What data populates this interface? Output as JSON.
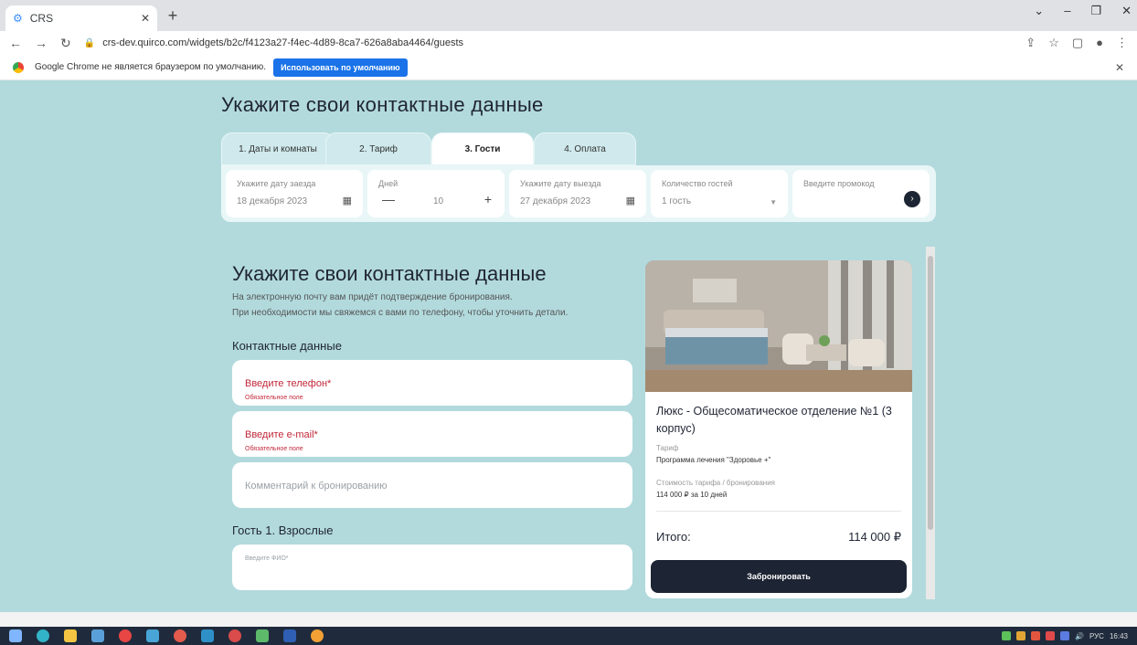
{
  "browser": {
    "tab_title": "CRS",
    "url": "crs-dev.quirco.com/widgets/b2c/f4123a27-f4ec-4d89-8ca7-626a8aba4464/guests",
    "infobar_text": "Google Chrome не является браузером по умолчанию.",
    "infobar_button": "Использовать по умолчанию"
  },
  "page": {
    "header_title": "Укажите свои контактные данные",
    "steps": [
      "1. Даты и комнаты",
      "2. Тариф",
      "3. Гости",
      "4. Оплата"
    ],
    "active_step": 3
  },
  "filters": {
    "checkin_label": "Укажите дату заезда",
    "checkin_value": "18 декабря 2023",
    "days_label": "Дней",
    "days_value": "10",
    "checkout_label": "Укажите дату выезда",
    "checkout_value": "27 декабря 2023",
    "guests_label": "Количество гостей",
    "guests_value": "1 гость",
    "promo_label": "Введите промокод"
  },
  "form": {
    "title": "Укажите свои контактные данные",
    "desc_line1": "На электронную почту вам придёт подтверждение бронирования.",
    "desc_line2": "При необходимости мы свяжемся с вами по телефону, чтобы уточнить детали.",
    "contact_heading": "Контактные данные",
    "phone_placeholder": "Введите телефон*",
    "phone_error": "Обязательное поле",
    "email_placeholder": "Введите e-mail*",
    "email_error": "Обязательное поле",
    "comment_placeholder": "Комментарий к бронированию",
    "guest_heading": "Гость 1. Взрослые",
    "fio_placeholder": "Введите ФИО*"
  },
  "room": {
    "title": "Люкс - Общесоматическое отделение №1 (3 корпус)",
    "tariff_label": "Тариф",
    "tariff_value": "Программа лечения \"Здоровье +\"",
    "price_label": "Стоимость тарифа / бронирования",
    "price_value": "114 000 ₽ за 10 дней",
    "total_label": "Итого:",
    "total_value": "114 000 ₽",
    "book_button": "Забронировать"
  },
  "taskbar": {
    "lang": "РУС",
    "time": "16:43"
  }
}
